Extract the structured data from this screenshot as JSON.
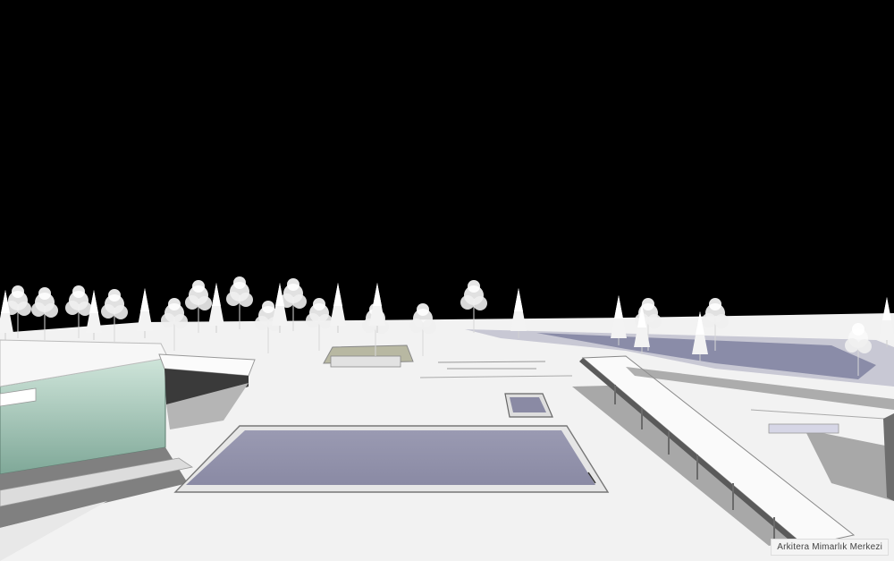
{
  "watermark": {
    "text": "Arkitera Mimarlık Merkezi"
  },
  "colors": {
    "sky": "#000000",
    "ground": "#f2f2f2",
    "water": "#8e8ea6",
    "glass": "#9fc4b3",
    "shadow": "#9a9a9a",
    "trees": "#ffffff"
  }
}
